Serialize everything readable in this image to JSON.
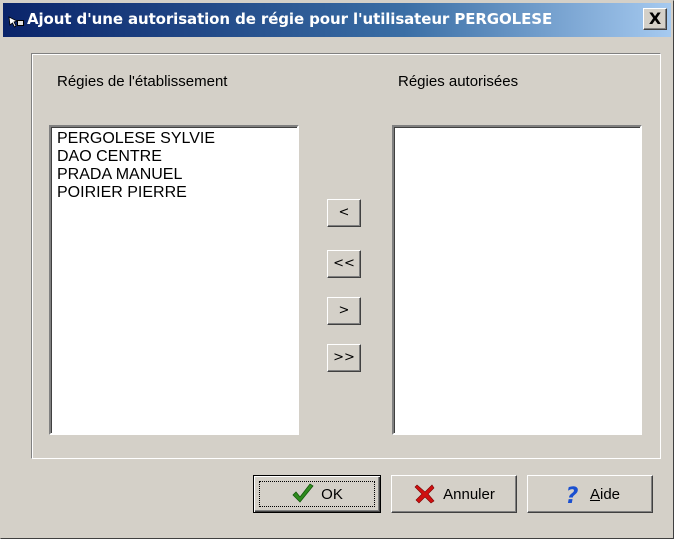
{
  "window": {
    "title": "Ajout d'une autorisation de régie pour l'utilisateur PERGOLESE",
    "close_label": "X"
  },
  "left_list": {
    "label": "Régies de l'établissement",
    "items": [
      "PERGOLESE SYLVIE",
      "DAO CENTRE",
      "PRADA MANUEL",
      "POIRIER PIERRE"
    ]
  },
  "right_list": {
    "label": "Régies autorisées",
    "items": []
  },
  "transfer_buttons": {
    "remove_one": "<",
    "remove_all": "<<",
    "add_one": ">",
    "add_all": ">>"
  },
  "buttons": {
    "ok": "OK",
    "cancel": "Annuler",
    "help_mnemonic": "A",
    "help_rest": "ide"
  },
  "icons": {
    "title": "app-pointer-icon",
    "ok": "checkmark-icon",
    "cancel": "red-x-icon",
    "help": "question-mark-icon"
  },
  "colors": {
    "title_start": "#0a246a",
    "title_end": "#a6caf0",
    "face": "#d4d0c8",
    "ok_check": "#2e8b1e",
    "cancel_x": "#d01010",
    "help_q": "#1a4fd0"
  }
}
